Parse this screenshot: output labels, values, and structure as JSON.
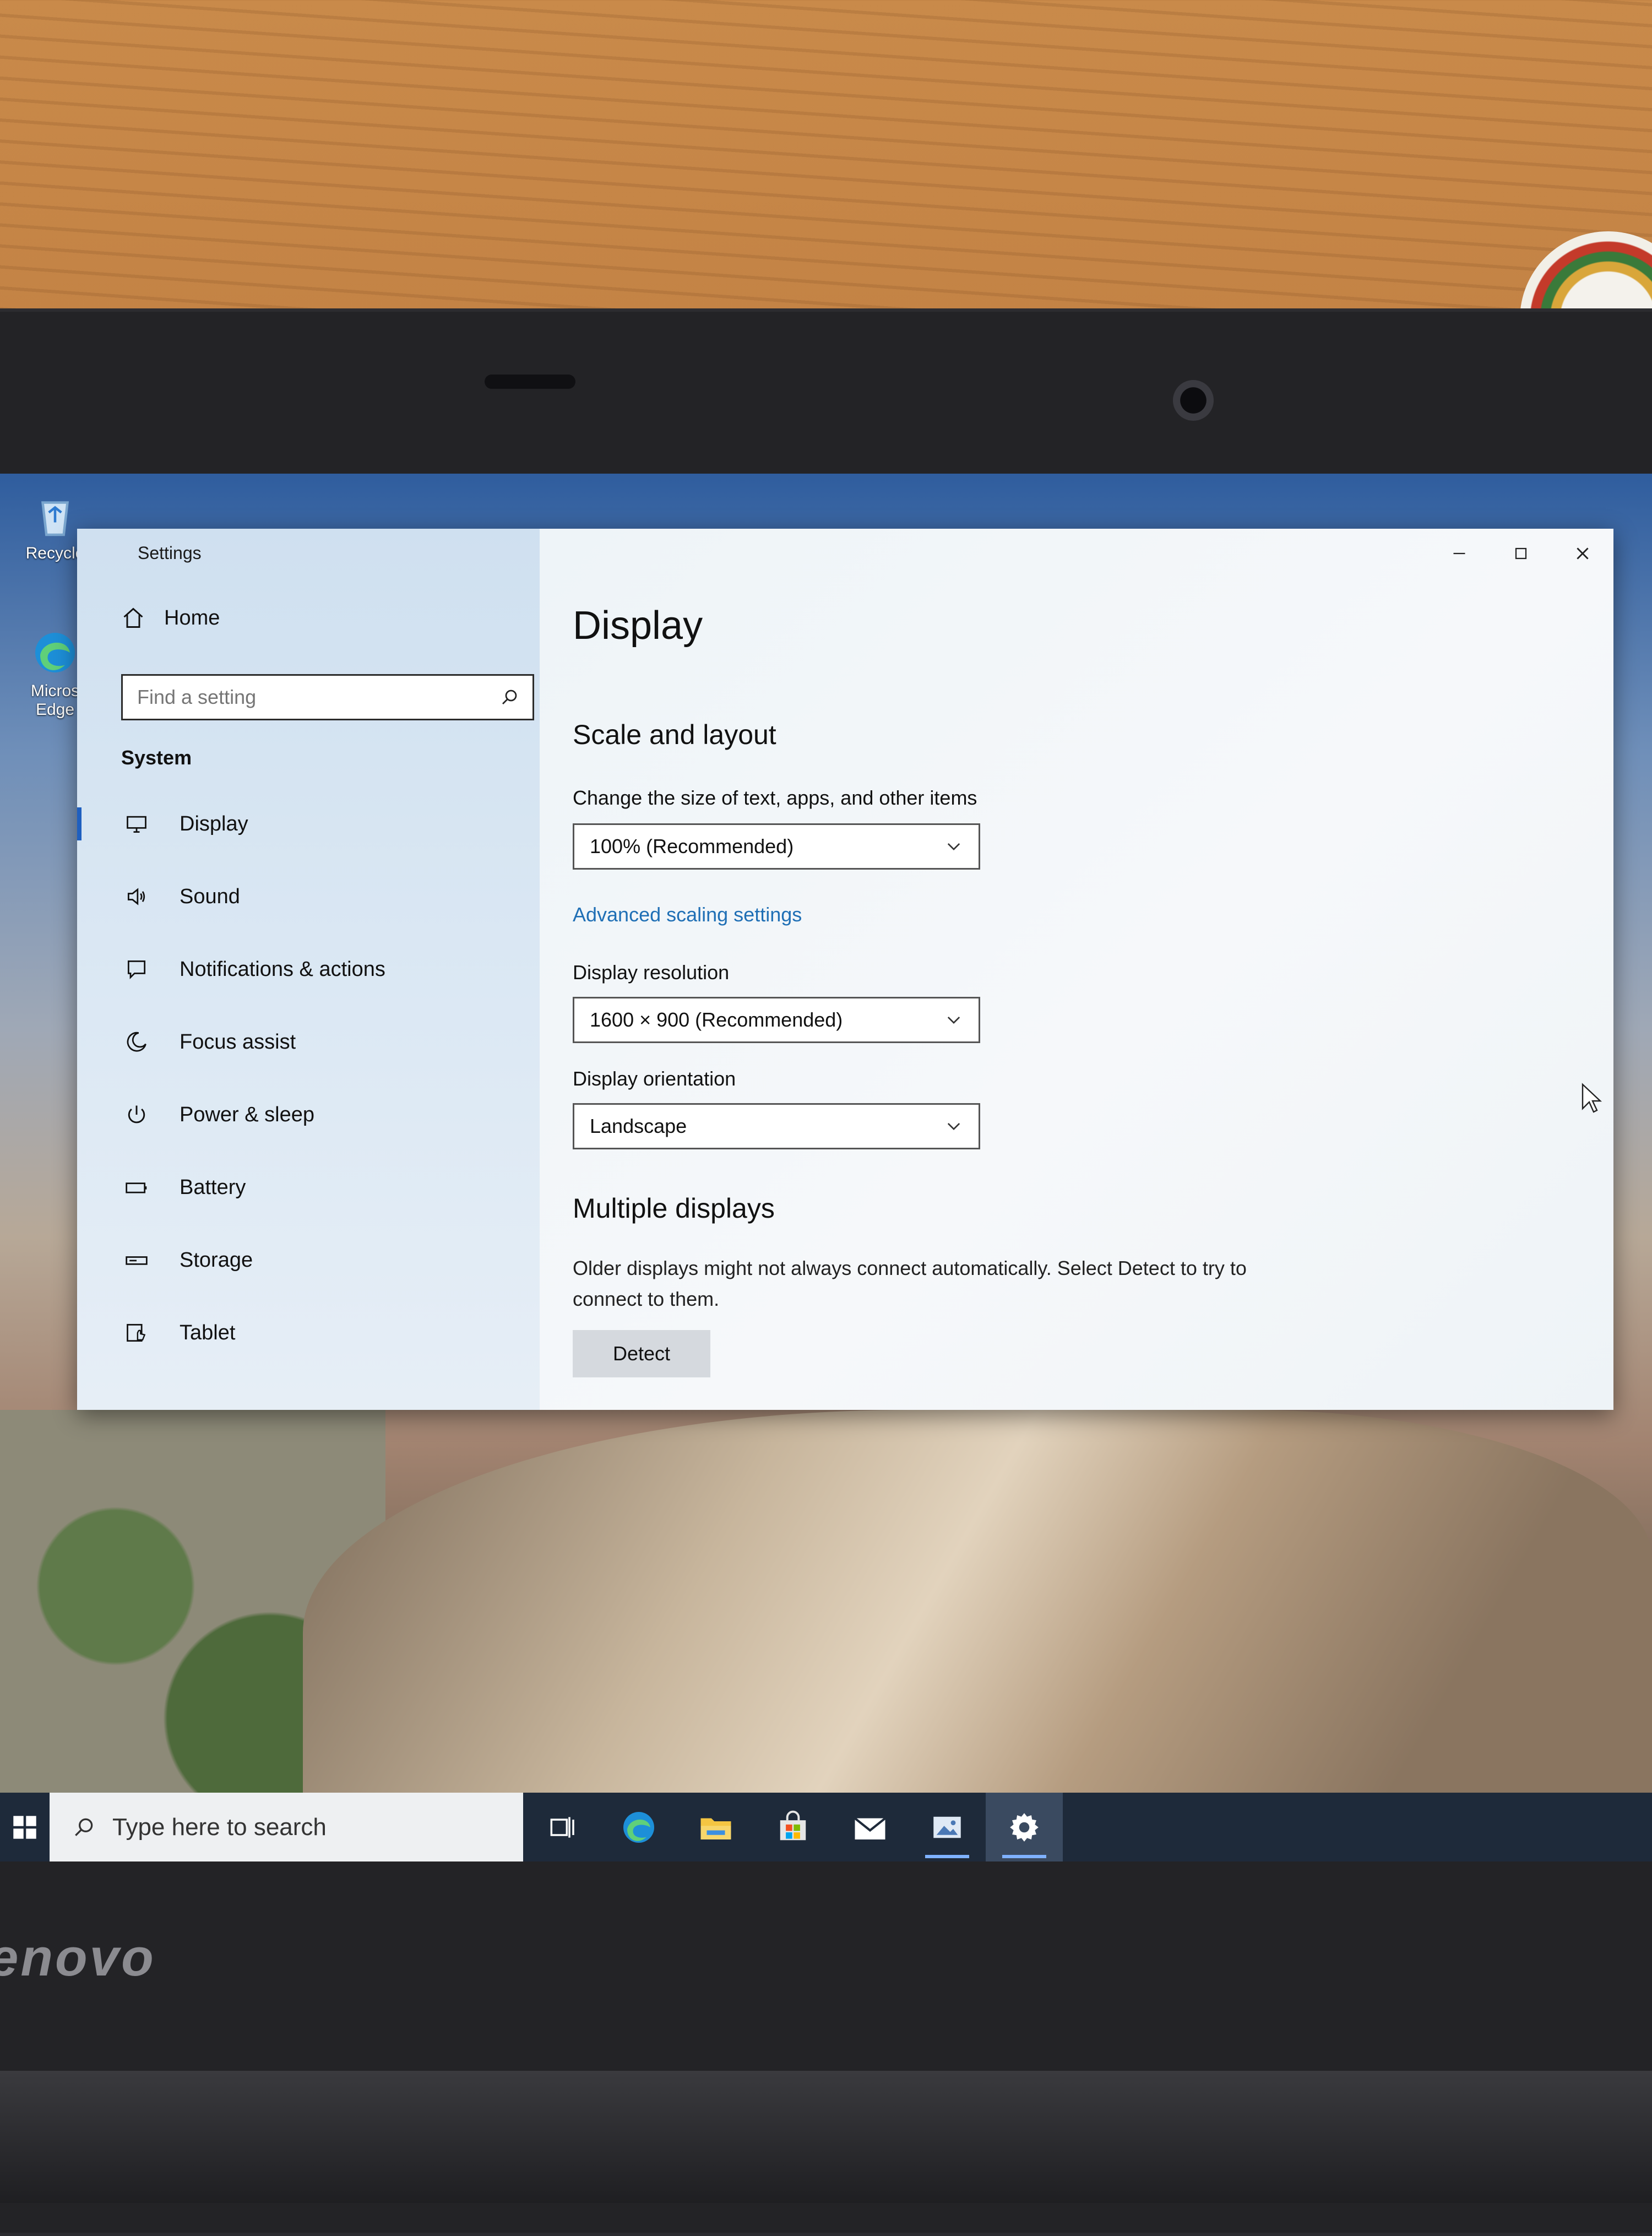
{
  "window": {
    "title": "Settings",
    "minimize_glyph": "—",
    "maximize_glyph": "☐",
    "close_glyph": "✕"
  },
  "sidebar": {
    "home_label": "Home",
    "search": {
      "placeholder": "Find a setting",
      "value": ""
    },
    "section_label": "System",
    "items": [
      {
        "label": "Display",
        "icon": "monitor-icon",
        "active": true
      },
      {
        "label": "Sound",
        "icon": "speaker-icon"
      },
      {
        "label": "Notifications & actions",
        "icon": "notification-icon"
      },
      {
        "label": "Focus assist",
        "icon": "moon-icon"
      },
      {
        "label": "Power & sleep",
        "icon": "power-icon"
      },
      {
        "label": "Battery",
        "icon": "battery-icon"
      },
      {
        "label": "Storage",
        "icon": "storage-icon"
      },
      {
        "label": "Tablet",
        "icon": "tablet-icon"
      }
    ]
  },
  "main": {
    "page_title": "Display",
    "scale_section": {
      "heading": "Scale and layout",
      "size_label": "Change the size of text, apps, and other items",
      "size_value": "100% (Recommended)",
      "advanced_link": "Advanced scaling settings",
      "resolution_label": "Display resolution",
      "resolution_value": "1600 × 900 (Recommended)",
      "orientation_label": "Display orientation",
      "orientation_value": "Landscape"
    },
    "multiple_section": {
      "heading": "Multiple displays",
      "description": "Older displays might not always connect automatically. Select Detect to try to connect to them.",
      "detect_label": "Detect"
    }
  },
  "desktop": {
    "icons": [
      {
        "label": "Recycle",
        "icon": "recycle-bin-icon"
      },
      {
        "label": "Micros Edge",
        "icon": "edge-icon"
      }
    ]
  },
  "taskbar": {
    "search_placeholder": "Type here to search",
    "apps": [
      "task-view-icon",
      "edge-icon",
      "file-explorer-icon",
      "store-icon",
      "mail-icon",
      "photos-icon",
      "settings-gear-icon"
    ],
    "active_app": "settings-gear-icon"
  },
  "hardware": {
    "brand": "enovo"
  },
  "colors": {
    "accent": "#1f5fbf",
    "link": "#1f6fb5",
    "taskbar": "#1e2a3a"
  }
}
